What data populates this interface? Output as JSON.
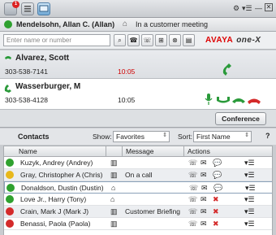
{
  "toolbar": {
    "notifications_badge": "1"
  },
  "identity": {
    "user_name": "Mendelsohn, Allan C. (Allan)",
    "presence_status": "In a customer meeting"
  },
  "search": {
    "placeholder": "Enter name or number"
  },
  "brand": {
    "avaya": "AVAYA",
    "onex": "one-X"
  },
  "calls": [
    {
      "name": "Alvarez, Scott",
      "number": "303-538-7141",
      "duration": "10:05"
    },
    {
      "name": "Wasserburger, M",
      "number": "303-538-4128",
      "duration": "10:05"
    }
  ],
  "conference_label": "Conference",
  "contacts": {
    "title": "Contacts",
    "show_label": "Show:",
    "show_value": "Favorites",
    "sort_label": "Sort:",
    "sort_value": "First Name",
    "help": "?",
    "columns": {
      "name": "Name",
      "message": "Message",
      "actions": "Actions"
    },
    "rows": [
      {
        "name": "Kuzyk, Andrey (Andrey)",
        "message": "",
        "status": "available"
      },
      {
        "name": "Gray, Christopher A (Chris)",
        "message": "On a call",
        "status": "busy"
      },
      {
        "name": "Donaldson, Dustin (Dustin)",
        "message": "",
        "status": "available"
      },
      {
        "name": "Love Jr., Harry (Tony)",
        "message": "",
        "status": "available"
      },
      {
        "name": "Crain, Mark J (Mark J)",
        "message": "Customer Briefing",
        "status": "dnd"
      },
      {
        "name": "Benassi, Paola (Paola)",
        "message": "",
        "status": "dnd"
      }
    ]
  },
  "colors": {
    "available": "#2fa12f",
    "busy": "#e8b81c",
    "dnd": "#d42a2a",
    "call_time": "#d00000",
    "accent_green": "#2a9a3a"
  }
}
